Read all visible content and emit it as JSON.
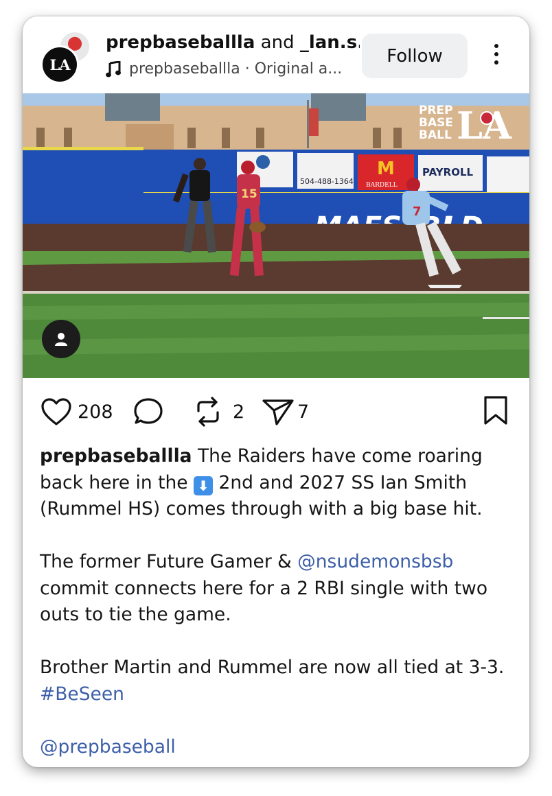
{
  "header": {
    "author": "prepbaseballla",
    "connector": "and",
    "coauthor": "_lan.s..",
    "audio": "prepbaseballla · Original a...",
    "follow_label": "Follow",
    "avatar_text": "LA"
  },
  "media": {
    "watermark_line1": "PREP",
    "watermark_line2": "BASE",
    "watermark_line3": "BALL",
    "watermark_la": "LA",
    "banner_phone": "504-488-1364",
    "banner_payroll": "PAYROLL",
    "banner_mcd": "M",
    "banner_bardell": "BARDELL",
    "wall_text": "MAESTRI",
    "wall_text_end": "LD",
    "player_number_red": "15",
    "player_number_blue": "7"
  },
  "actions": {
    "likes": "208",
    "reposts": "2",
    "shares": "7"
  },
  "caption": {
    "username": "prepbaseballla",
    "text1_a": " The Raiders have come roaring back here in the ",
    "emoji": "⬇",
    "text1_b": " 2nd and 2027 SS Ian Smith (Rummel HS) comes through with a big base hit.",
    "text2_a": "The former Future Gamer & ",
    "mention1": "@nsudemonsbsb",
    "text2_b": " commit connects here for a 2 RBI single with two outs to tie the game.",
    "text3": "Brother Martin and Rummel are now all tied at 3-3.",
    "hashtag": "#BeSeen",
    "mention2": "@prepbaseball"
  },
  "colors": {
    "link": "#3d5fa8",
    "wall_blue": "#1f4fb4",
    "grass": "#4f8a3a"
  }
}
